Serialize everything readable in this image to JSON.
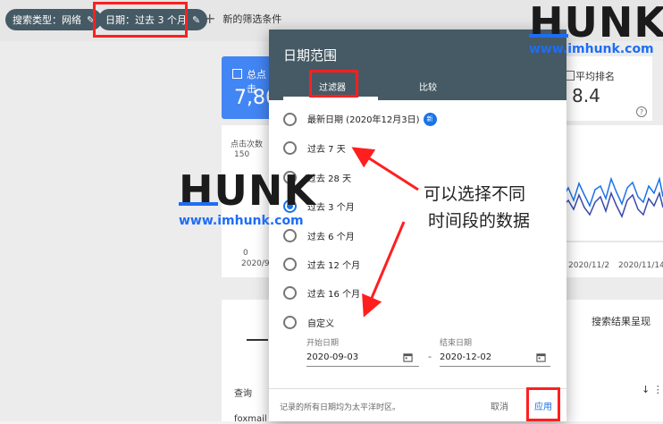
{
  "filters": {
    "search_type": "搜索类型：网络",
    "date": "日期：过去 3 个月",
    "add_filter": "新的筛选条件"
  },
  "background": {
    "clicks_card_label": "总点击",
    "clicks_card_value": "7,86",
    "chart_left_label": "点击次数",
    "chart_left_tick": "150",
    "chart_left_zero": "0",
    "chart_left_date": "2020/9/",
    "avg_position_label": "平均排名",
    "avg_position_value": "8.4",
    "chart_right_dates": [
      "2020/11/2",
      "2020/11/14"
    ],
    "table_tab": "搜索结果呈现",
    "table_header_query": "查询",
    "table_row_query": "foxmail"
  },
  "dialog": {
    "title": "日期范围",
    "tabs": [
      "过滤器",
      "比较"
    ],
    "options": [
      {
        "label": "最新日期 (2020年12月3日)",
        "badge": "新",
        "checked": false
      },
      {
        "label": "过去 7 天",
        "checked": false
      },
      {
        "label": "过去 28 天",
        "checked": false
      },
      {
        "label": "过去 3 个月",
        "checked": true
      },
      {
        "label": "过去 6 个月",
        "checked": false
      },
      {
        "label": "过去 12 个月",
        "checked": false
      },
      {
        "label": "过去 16 个月",
        "checked": false
      },
      {
        "label": "自定义",
        "checked": false
      }
    ],
    "start_label": "开始日期",
    "start_value": "2020-09-03",
    "end_label": "结束日期",
    "end_value": "2020-12-02",
    "note": "记录的所有日期均为太平洋时区。",
    "cancel": "取消",
    "apply": "应用"
  },
  "annotation": {
    "line1": "可以选择不同",
    "line2": "时间段的数据"
  },
  "watermark": {
    "logo": "HUNK",
    "url": "www.imhunk.com"
  },
  "colors": {
    "header": "#455a64",
    "accent": "#1a73e8",
    "highlight": "#ff1f1f"
  }
}
